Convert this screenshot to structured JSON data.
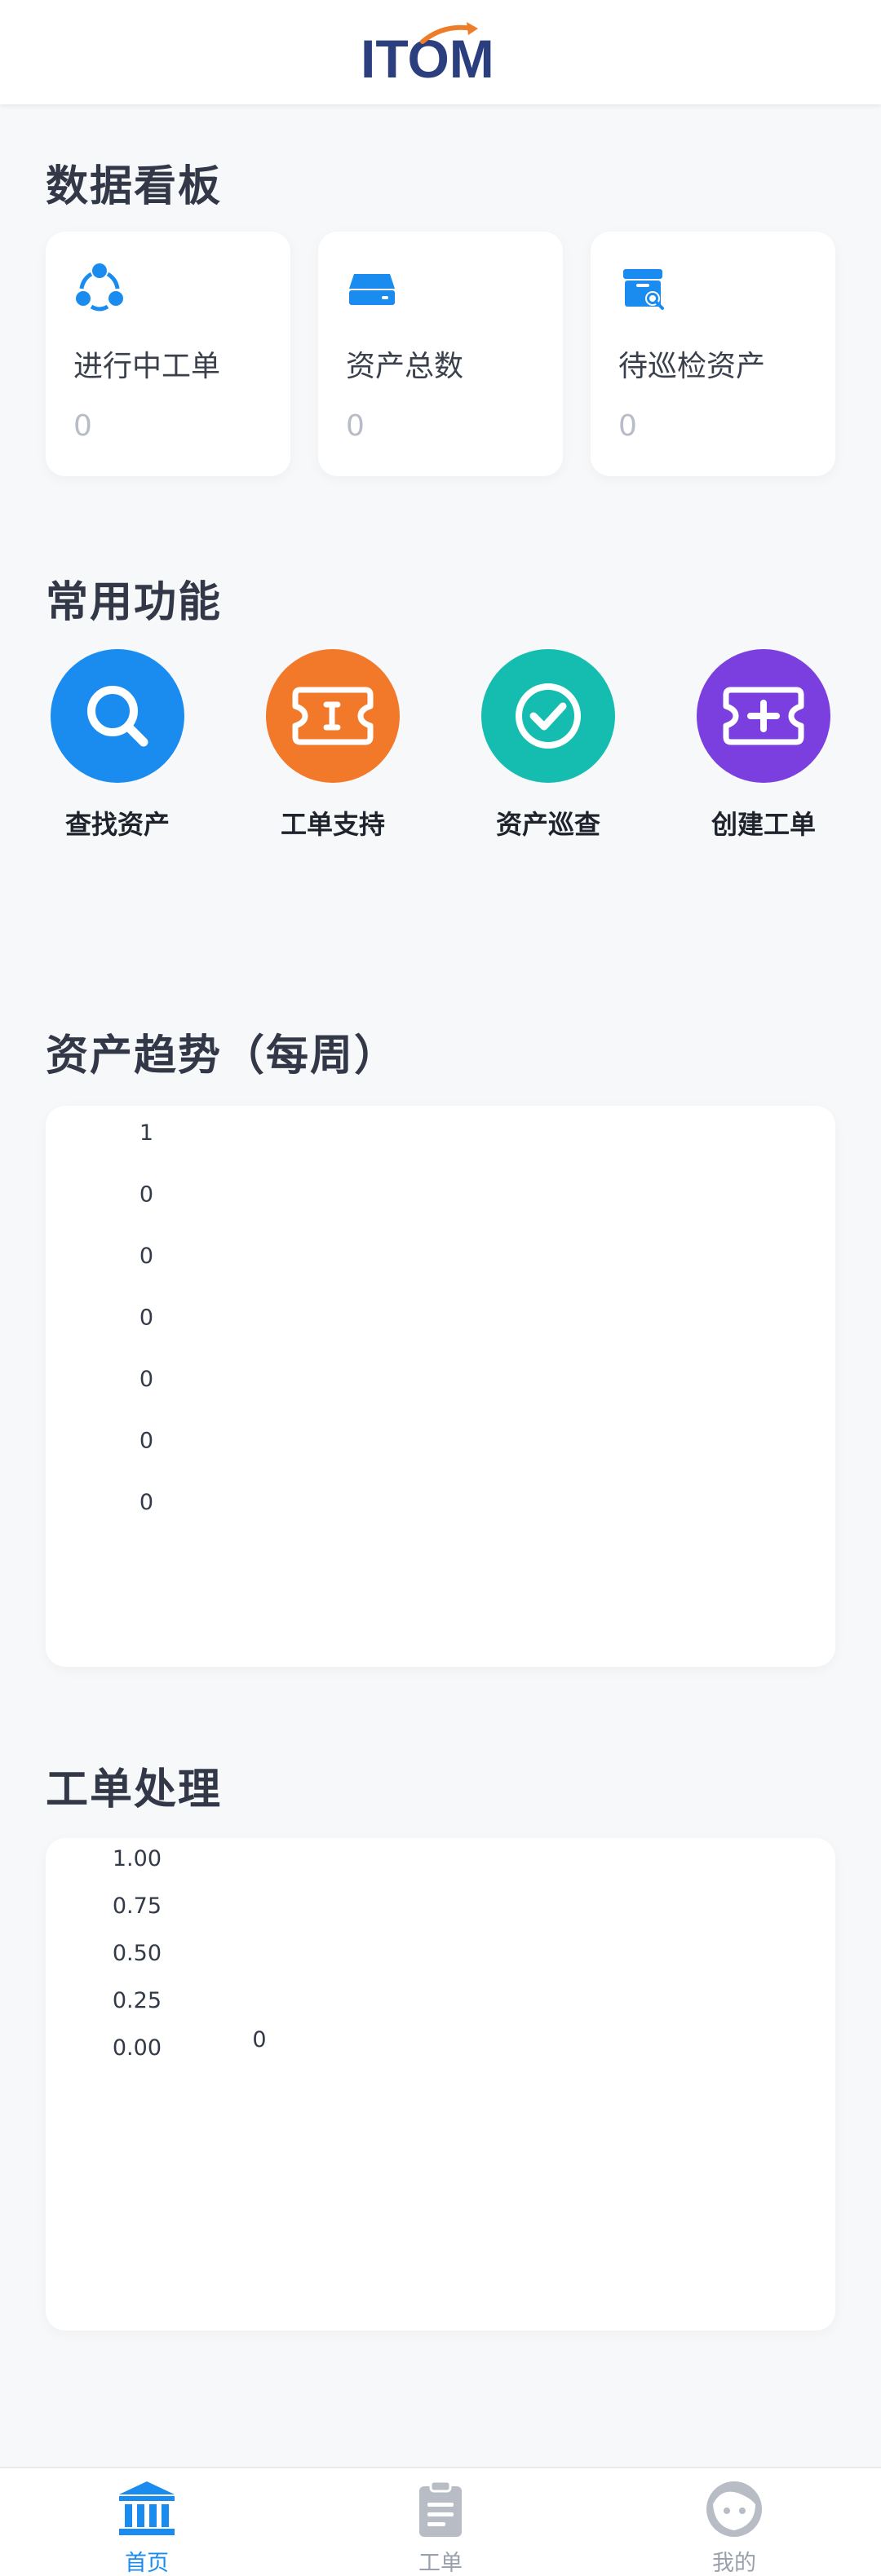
{
  "header": {
    "logo_text": "ITOM"
  },
  "dashboard": {
    "title": "数据看板",
    "cards": [
      {
        "icon": "share-icon",
        "label": "进行中工单",
        "value": "0"
      },
      {
        "icon": "server-icon",
        "label": "资产总数",
        "value": "0"
      },
      {
        "icon": "inspect-box-icon",
        "label": "待巡检资产",
        "value": "0"
      }
    ]
  },
  "functions": {
    "title": "常用功能",
    "items": [
      {
        "icon": "search-icon",
        "label": "查找资产",
        "color": "#1a8cf0"
      },
      {
        "icon": "ticket-icon",
        "label": "工单支持",
        "color": "#f2782a"
      },
      {
        "icon": "check-circle-icon",
        "label": "资产巡查",
        "color": "#15bdb0"
      },
      {
        "icon": "ticket-add-icon",
        "label": "创建工单",
        "color": "#7b3fe0"
      }
    ]
  },
  "asset_trend": {
    "title": "资产趋势（每周）",
    "y_ticks": [
      "1",
      "0",
      "0",
      "0",
      "0",
      "0",
      "0"
    ]
  },
  "ticket_processing": {
    "title": "工单处理",
    "y_ticks": [
      "1.00",
      "0.75",
      "0.50",
      "0.25",
      "0.00"
    ],
    "data_label": "0"
  },
  "chart_data": [
    {
      "type": "line",
      "title": "资产趋势（每周）",
      "xlabel": "",
      "ylabel": "",
      "y_tick_labels": [
        "1",
        "0",
        "0",
        "0",
        "0",
        "0",
        "0"
      ],
      "series": [
        {
          "values": []
        }
      ]
    },
    {
      "type": "bar",
      "title": "工单处理",
      "xlabel": "",
      "ylabel": "",
      "ylim": [
        0,
        1
      ],
      "y_tick_labels": [
        "1.00",
        "0.75",
        "0.50",
        "0.25",
        "0.00"
      ],
      "series": [
        {
          "values": [
            0
          ]
        }
      ],
      "data_labels": [
        "0"
      ]
    }
  ],
  "bottom_nav": {
    "items": [
      {
        "icon": "bank-icon",
        "label": "首页",
        "active": true
      },
      {
        "icon": "clipboard-icon",
        "label": "工单",
        "active": false
      },
      {
        "icon": "face-icon",
        "label": "我的",
        "active": false
      }
    ]
  },
  "colors": {
    "accent": "#1a8cf0",
    "logo_blue": "#2b3f7e",
    "logo_orange": "#ee7d2a",
    "inactive": "#9aa0ab"
  }
}
